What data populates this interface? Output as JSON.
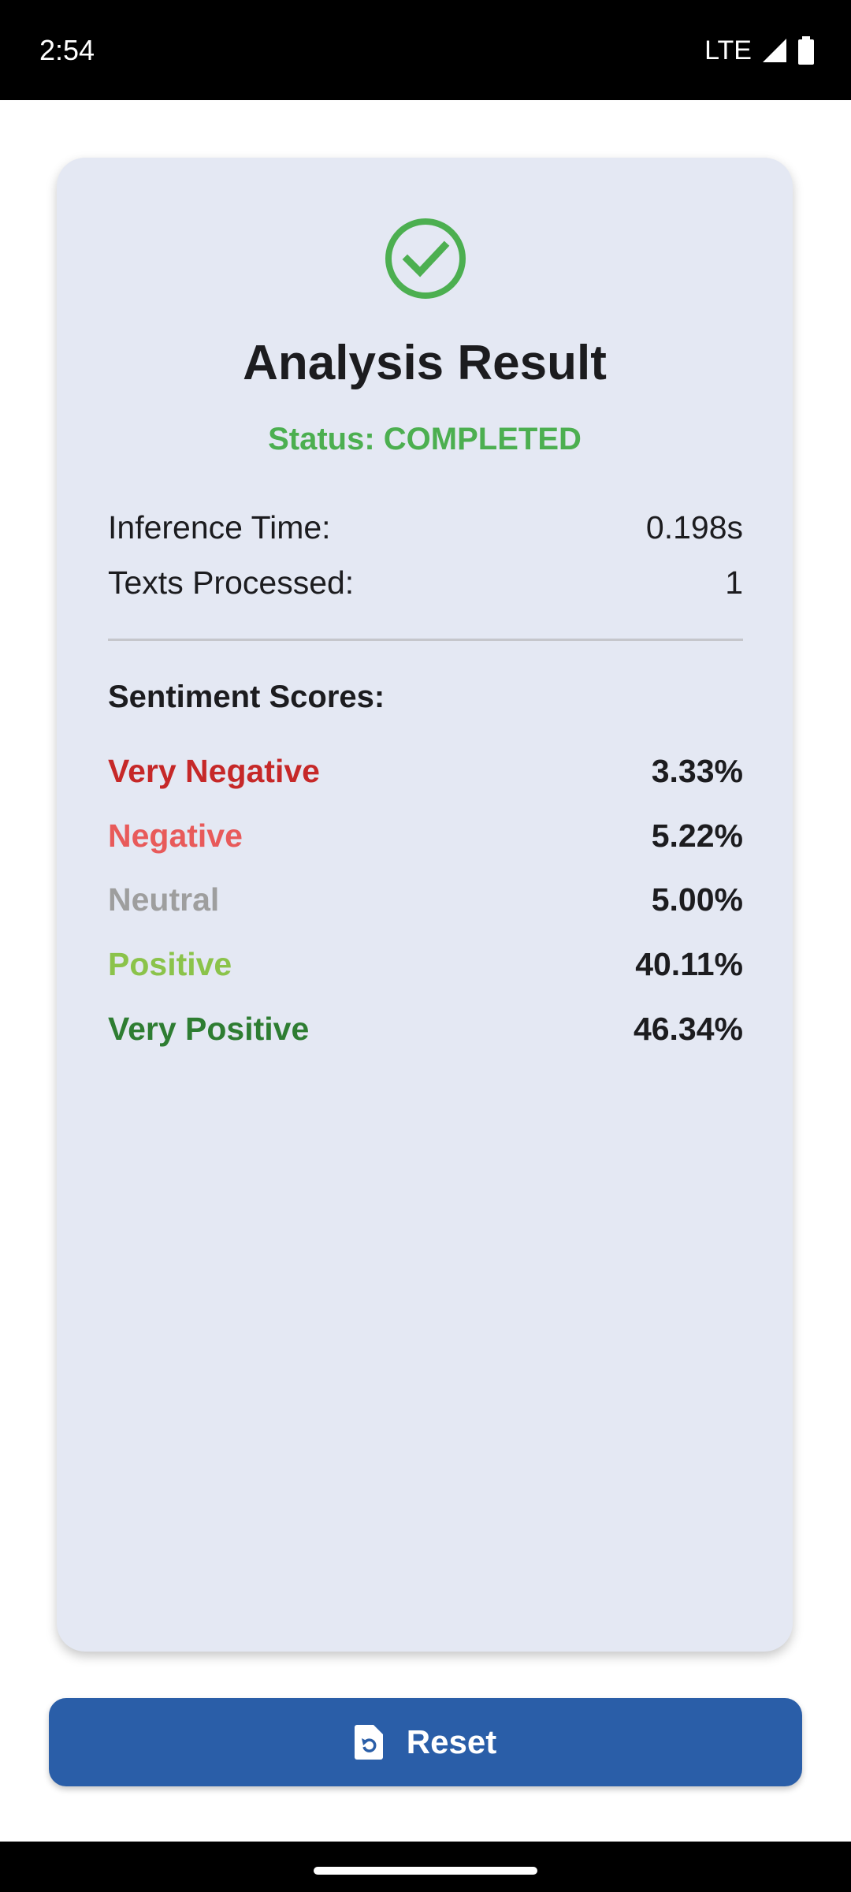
{
  "status_bar": {
    "time": "2:54",
    "network": "LTE",
    "signal_icon": "cell-signal-icon",
    "battery_icon": "battery-icon"
  },
  "result": {
    "icon": "check-circle-icon",
    "title": "Analysis Result",
    "status": "Status: COMPLETED",
    "status_color": "#4caf50",
    "info": [
      {
        "label": "Inference Time:",
        "value": "0.198s"
      },
      {
        "label": "Texts Processed:",
        "value": "1"
      }
    ],
    "scores_heading": "Sentiment Scores:",
    "scores": [
      {
        "label": "Very Negative",
        "value": "3.33%",
        "color": "#c62828"
      },
      {
        "label": "Negative",
        "value": "5.22%",
        "color": "#e85a5a"
      },
      {
        "label": "Neutral",
        "value": "5.00%",
        "color": "#9e9e9e"
      },
      {
        "label": "Positive",
        "value": "40.11%",
        "color": "#8bc34a"
      },
      {
        "label": "Very Positive",
        "value": "46.34%",
        "color": "#2e7d32"
      }
    ]
  },
  "actions": {
    "reset_label": "Reset",
    "reset_icon": "reset-document-icon",
    "button_color": "#2a5ea8"
  }
}
